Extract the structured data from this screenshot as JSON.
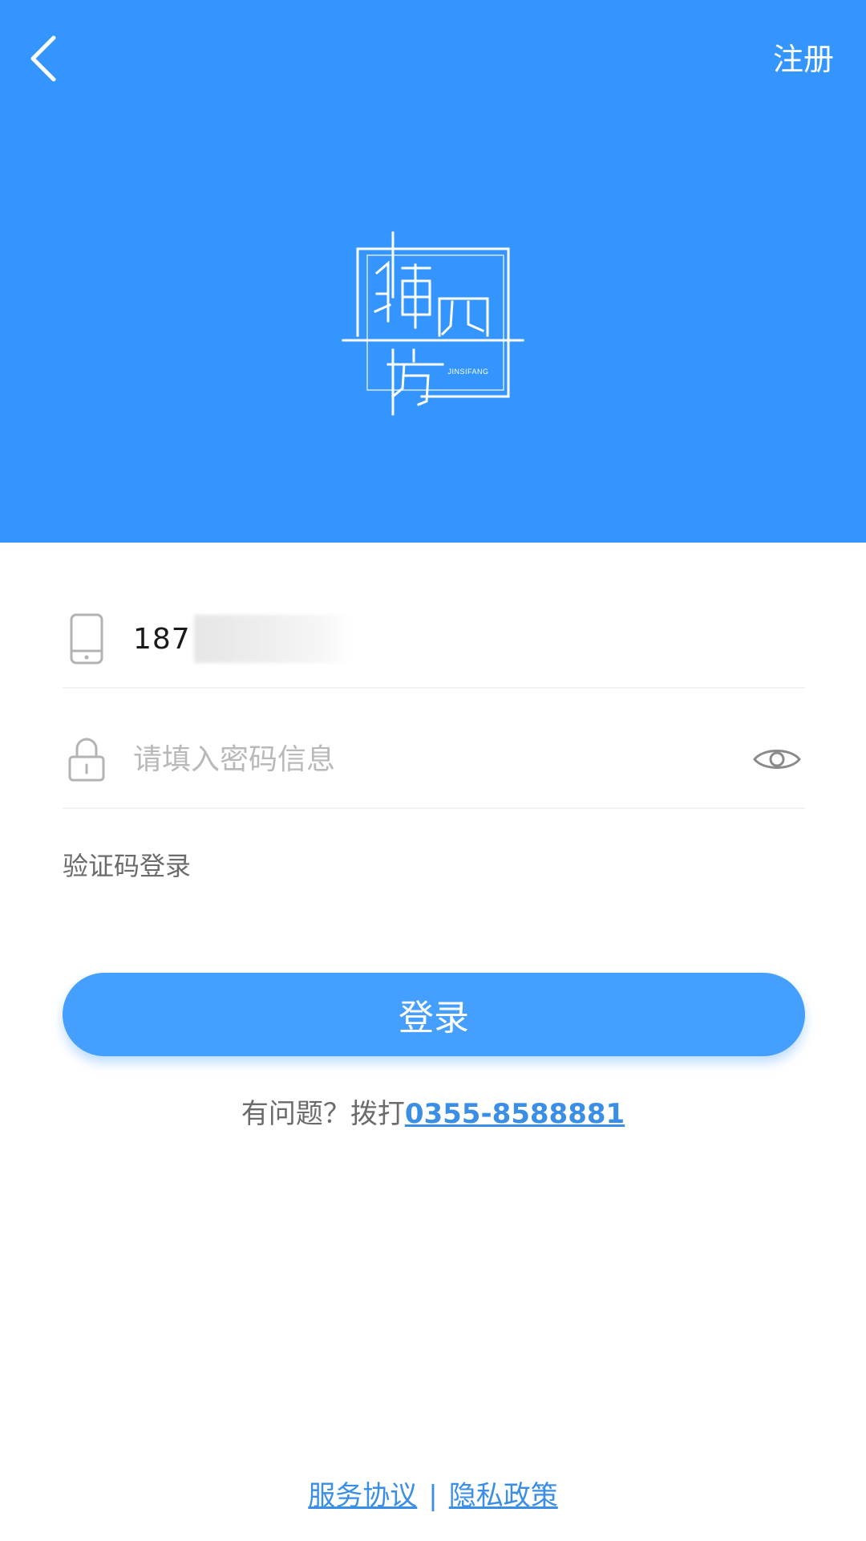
{
  "header": {
    "register_label": "注册"
  },
  "logo": {
    "caption": "JINSIFANG"
  },
  "form": {
    "phone_visible": "187",
    "password_placeholder": "请填入密码信息",
    "code_login_label": "验证码登录",
    "login_label": "登录"
  },
  "help": {
    "prefix": "有问题？拨打",
    "phone": "0355-8588881"
  },
  "footer": {
    "service_label": "服务协议",
    "separator": "|",
    "privacy_label": "隐私政策"
  },
  "colors": {
    "header_bg": "#3395fd",
    "login_button": "#459ffe",
    "link": "#3a8ee6"
  }
}
